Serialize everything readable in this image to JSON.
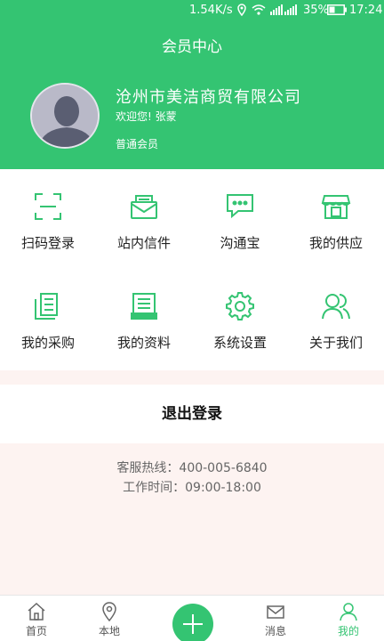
{
  "status_bar": {
    "speed": "1.54K/s",
    "battery": "35%",
    "time": "17:24"
  },
  "header": {
    "title": "会员中心",
    "company": "沧州市美洁商贸有限公司",
    "welcome": "欢迎您! 张蒙",
    "member_level": "普通会员"
  },
  "grid": [
    {
      "label": "扫码登录",
      "icon": "scan-icon"
    },
    {
      "label": "站内信件",
      "icon": "mail-icon"
    },
    {
      "label": "沟通宝",
      "icon": "chat-icon"
    },
    {
      "label": "我的供应",
      "icon": "store-icon"
    },
    {
      "label": "我的采购",
      "icon": "purchase-icon"
    },
    {
      "label": "我的资料",
      "icon": "profile-data-icon"
    },
    {
      "label": "系统设置",
      "icon": "gear-icon"
    },
    {
      "label": "关于我们",
      "icon": "users-icon"
    }
  ],
  "logout_label": "退出登录",
  "contact": {
    "hotline": "客服热线：400-005-6840",
    "hours": "工作时间：09:00-18:00"
  },
  "nav": [
    {
      "label": "首页",
      "icon": "home-icon"
    },
    {
      "label": "本地",
      "icon": "location-icon"
    },
    {
      "label": "消息",
      "icon": "message-icon"
    },
    {
      "label": "我的",
      "icon": "user-icon"
    }
  ],
  "colors": {
    "brand": "#34c472",
    "background": "#fdf3f1"
  }
}
